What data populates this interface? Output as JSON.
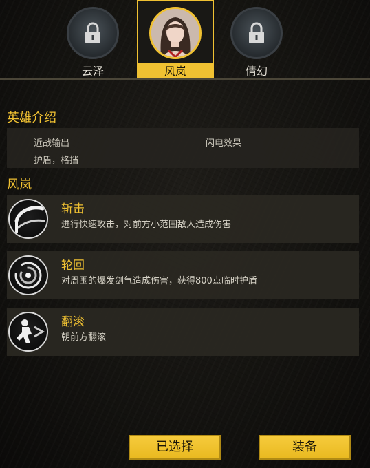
{
  "heroes": [
    {
      "name": "云泽",
      "locked": true
    },
    {
      "name": "风岚",
      "locked": false,
      "selected": true
    },
    {
      "name": "倩幻",
      "locked": true
    }
  ],
  "intro": {
    "title": "英雄介绍",
    "tags": [
      "近战输出",
      "闪电效果",
      "护盾，格挡"
    ]
  },
  "hero_title": "风岚",
  "skills": [
    {
      "name": "斩击",
      "desc": "进行快速攻击，对前方小范围敌人造成伤害",
      "icon": "slash-icon"
    },
    {
      "name": "轮回",
      "desc": "对周围的爆发剑气造成伤害，获得800点临时护盾",
      "icon": "whirl-icon"
    },
    {
      "name": "翻滚",
      "desc": "朝前方翻滚",
      "icon": "roll-icon"
    }
  ],
  "buttons": {
    "selected": "已选择",
    "equip": "装备"
  },
  "colors": {
    "accent": "#f0c132",
    "panel": "#2a2822",
    "text": "#d4d0c4"
  }
}
